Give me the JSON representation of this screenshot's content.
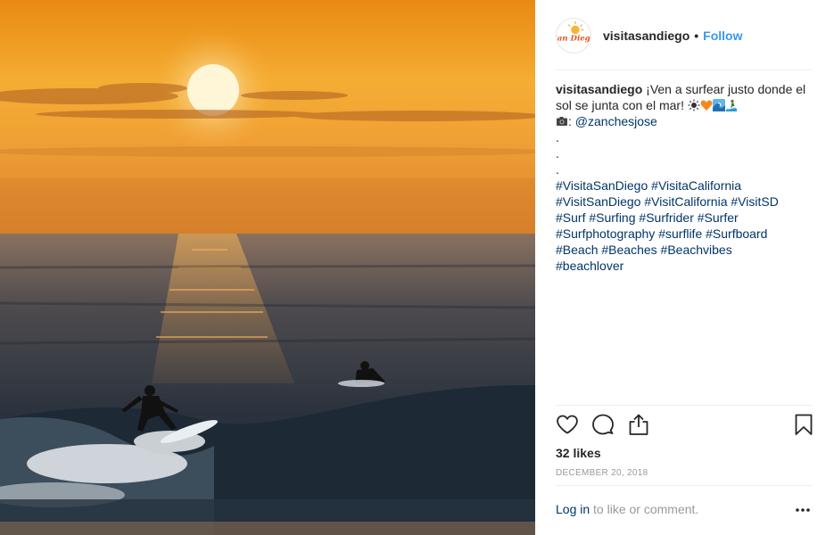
{
  "post": {
    "photo": {
      "description_icon": "sunset-surf-photo",
      "colors": {
        "sky_top": "#e88a14",
        "sky_horizon": "#f6b03a",
        "sun": "#fff7d6",
        "sea": "#2a3340"
      }
    },
    "header": {
      "avatar_text": "San Diego",
      "username": "visitasandiego",
      "dot": "•",
      "follow_label": "Follow"
    },
    "caption": {
      "username": "visitasandiego",
      "text_line1": " ¡Ven a surfear justo donde el",
      "text_line2": "sol se junta con el mar! ",
      "camera_prefix": "📷: ",
      "mention": "@zanchesjose",
      "dots": [
        ".",
        ".",
        "."
      ],
      "hashtag_lines": [
        [
          "#VisitaSanDiego",
          "#VisitaCalifornia"
        ],
        [
          "#VisitSanDiego",
          "#VisitCalifornia",
          "#VisitSD"
        ],
        [
          "#Surf",
          "#Surfing",
          "#Surfrider",
          "#Surfer"
        ],
        [
          "#Surfphotography",
          "#surflife",
          "#Surfboard"
        ],
        [
          "#Beach",
          "#Beaches",
          "#Beachvibes"
        ],
        [
          "#beachlover"
        ]
      ]
    },
    "actions": {
      "like_icon": "heart-icon",
      "comment_icon": "comment-icon",
      "share_icon": "share-icon",
      "save_icon": "bookmark-icon"
    },
    "likes": "32 likes",
    "date": "DECEMBER 20, 2018",
    "footer": {
      "login_label": "Log in",
      "rest": " to like or comment.",
      "more_icon": "more-options-icon"
    }
  },
  "colors": {
    "link": "#003569",
    "follow": "#3897f0",
    "muted": "#999999",
    "text": "#262626"
  }
}
